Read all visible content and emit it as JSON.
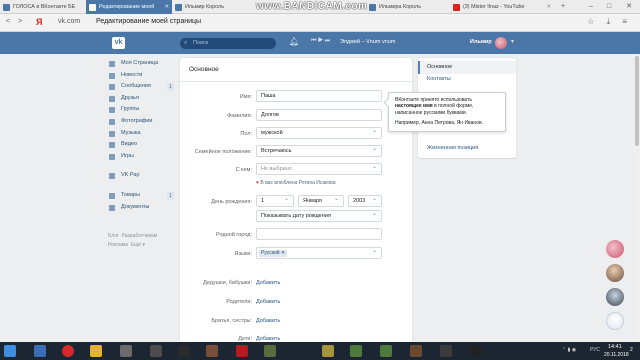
{
  "browser": {
    "tabs": [
      {
        "title": "ГОЛОСА в ВКонтакте БЕ",
        "active": false
      },
      {
        "title": "Редактирование моей",
        "active": true
      },
      {
        "title": "Ильмир Король",
        "active": false
      },
      {
        "title": "Ильмира Король",
        "active": false
      },
      {
        "title": "(3) Mister Ilnaz - YouTube",
        "active": false
      }
    ],
    "recording_watermark": "www.BANDICAM.com",
    "address_url": "vk.com",
    "page_title": "Редактирование моей страницы",
    "yandex_logo": "Я"
  },
  "header": {
    "search_placeholder": "Поиск",
    "track": "Элджей – Vnum vnum",
    "user_name": "Ильмир"
  },
  "left_menu": {
    "items": [
      {
        "label": "Моя Страница",
        "icon": "user-icon"
      },
      {
        "label": "Новости",
        "icon": "news-icon"
      },
      {
        "label": "Сообщения",
        "icon": "message-icon",
        "badge": "1"
      },
      {
        "label": "Друзья",
        "icon": "friends-icon"
      },
      {
        "label": "Группы",
        "icon": "groups-icon"
      },
      {
        "label": "Фотографии",
        "icon": "photo-icon"
      },
      {
        "label": "Музыка",
        "icon": "music-icon"
      },
      {
        "label": "Видео",
        "icon": "video-icon"
      },
      {
        "label": "Игры",
        "icon": "games-icon"
      }
    ],
    "pay": {
      "label": "VK Pay",
      "icon": "vkpay-icon"
    },
    "extras": [
      {
        "label": "Товары",
        "icon": "goods-icon",
        "badge": "1"
      },
      {
        "label": "Документы",
        "icon": "documents-icon"
      }
    ],
    "footer": [
      "Блог",
      "Разработчикам",
      "Реклама",
      "Ещё"
    ]
  },
  "main": {
    "title": "Основное",
    "fields": {
      "first_name_label": "Имя:",
      "first_name_value": "Паша",
      "last_name_label": "Фамилия:",
      "last_name_value": "Долгов",
      "gender_label": "Пол:",
      "gender_value": "мужской",
      "marital_label": "Семейное положение:",
      "marital_value": "Встречаюсь",
      "partner_label": "С кем:",
      "partner_value": "Не выбрано",
      "partner_hint": "В вас влюблена Регина Исакова",
      "birthday_label": "День рождения:",
      "birth_day": "1",
      "birth_month": "Января",
      "birth_year": "2003",
      "birthday_visibility": "Показывать дату рождения",
      "hometown_label": "Родной город:",
      "hometown_value": "",
      "languages_label": "Языки:",
      "language_tag": "Русский",
      "grandparents_label": "Дедушки, бабушки:",
      "parents_label": "Родители:",
      "siblings_label": "Братья, сестры:",
      "children_label": "Дети:",
      "add_link": "Добавить"
    }
  },
  "tooltip": {
    "line1": "ВКонтакте принято использовать",
    "bold": "настоящее имя",
    "line2": " в полной форме,",
    "line3": "написанное русскими буквами.",
    "example": "Например, Анна Петрова, Ян Иванов."
  },
  "right_menu": {
    "items": [
      {
        "label": "Основное",
        "active": true
      },
      {
        "label": "Контакты",
        "active": false
      },
      {
        "label": "Жизненная позиция",
        "active": false
      }
    ]
  },
  "taskbar": {
    "time": "14:41",
    "date": "20.11.2018",
    "lang": "РУС",
    "notify_count": "2"
  },
  "colors": {
    "vk_blue": "#4a76a8",
    "link": "#2a5885",
    "bg": "#edeef0"
  }
}
